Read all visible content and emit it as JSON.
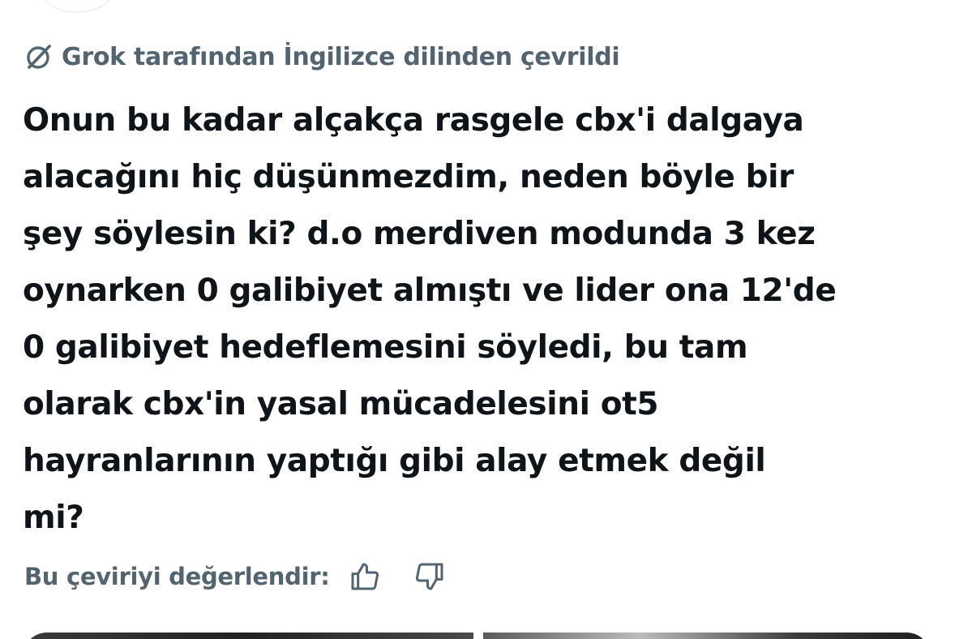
{
  "translation": {
    "attribution": "Grok tarafından İngilizce dilinden çevrildi",
    "icon": "grok-icon"
  },
  "tweet": {
    "text_lines": [
      "Onun bu kadar alçakça rasgele cbx'i dalgaya",
      "alacağını hiç düşünmezdim, neden böyle bir",
      "şey söylesin ki? d.o merdiven modunda 3 kez",
      "oynarken 0 galibiyet almıştı ve lider ona 12'de",
      "0 galibiyet hedeflemesini söyledi, bu tam",
      "olarak cbx'in yasal mücadelesini ot5",
      "hayranlarının yaptığı gibi alay etmek değil",
      "mi?"
    ]
  },
  "rating": {
    "label": "Bu çeviriyi değerlendir:",
    "thumbs_up_icon": "thumbs-up-icon",
    "thumbs_down_icon": "thumbs-down-icon"
  },
  "colors": {
    "text_primary": "#0f1419",
    "text_secondary": "#536471",
    "background": "#ffffff"
  }
}
